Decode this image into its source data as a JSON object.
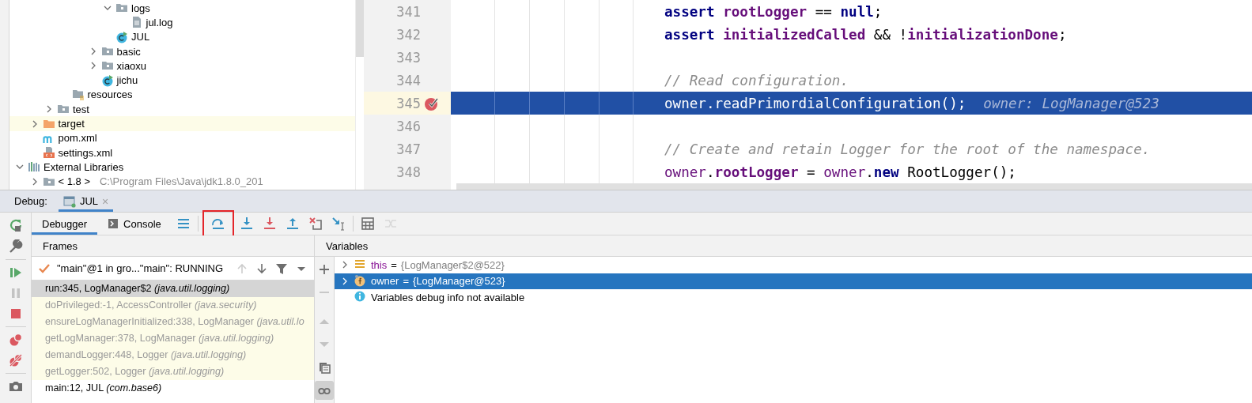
{
  "project_tree": {
    "items": [
      {
        "children": [
          {
            "children": [
              {
                "children": [
                  {
                    "children": [
                      {
                        "children": [
                          {
                            "children": [
                              {
                                "label": "logs",
                                "kind": "folder",
                                "expanded": true,
                                "selected": false,
                                "children": [
                                  {
                                    "label": "jul.log",
                                    "kind": "file",
                                    "selected": false
                                  }
                                ]
                              },
                              {
                                "label": "JUL",
                                "kind": "class",
                                "selected": false
                              }
                            ]
                          },
                          {
                            "label": "basic",
                            "kind": "folder",
                            "expanded": false,
                            "selected": false
                          },
                          {
                            "label": "xiaoxu",
                            "kind": "folder",
                            "expanded": false,
                            "selected": false
                          },
                          {
                            "label": "jichu",
                            "kind": "class",
                            "selected": false
                          }
                        ]
                      }
                    ]
                  },
                  {
                    "label": "resources",
                    "kind": "resources",
                    "selected": false
                  }
                ]
              },
              {
                "label": "test",
                "kind": "folder",
                "expanded": false,
                "selected": false
              }
            ]
          },
          {
            "label": "target",
            "kind": "excluded",
            "expanded": false,
            "selected": true
          },
          {
            "label": "pom.xml",
            "kind": "maven",
            "selected": false
          },
          {
            "label": "settings.xml",
            "kind": "settings",
            "selected": false
          }
        ]
      },
      {
        "label": "External Libraries",
        "kind": "libraries",
        "expanded": true,
        "selected": false,
        "children": [
          {
            "label": "< 1.8 >",
            "path": "C:\\Program Files\\Java\\jdk1.8.0_201",
            "kind": "folder",
            "expanded": false,
            "selected": false
          }
        ]
      }
    ]
  },
  "editor": {
    "lines": [
      {
        "number": "341",
        "current": false,
        "breakpoint": false,
        "tokens": [
          {
            "kind": "keyword",
            "text": "assert"
          },
          {
            "kind": "field",
            "text": " rootLogger"
          },
          {
            "kind": "plain",
            "text": " == "
          },
          {
            "kind": "keyword",
            "text": "null"
          },
          {
            "kind": "plain",
            "text": ";"
          }
        ]
      },
      {
        "number": "342",
        "current": false,
        "breakpoint": false,
        "tokens": [
          {
            "kind": "keyword",
            "text": "assert"
          },
          {
            "kind": "field",
            "text": " initializedCalled"
          },
          {
            "kind": "plain",
            "text": " && !"
          },
          {
            "kind": "field",
            "text": "initializationDone"
          },
          {
            "kind": "plain",
            "text": ";"
          }
        ]
      },
      {
        "number": "343",
        "current": false,
        "breakpoint": false
      },
      {
        "number": "344",
        "current": false,
        "breakpoint": false,
        "tokens": [
          {
            "kind": "comment",
            "text": "// Read configuration."
          }
        ]
      },
      {
        "number": "345",
        "current": true,
        "breakpoint": true,
        "tokens": [
          {
            "kind": "variable",
            "text": "owner"
          },
          {
            "kind": "plain",
            "text": ".readPrimordialConfiguration();"
          }
        ],
        "hint": "owner: LogManager@523"
      },
      {
        "number": "346",
        "current": false,
        "breakpoint": false
      },
      {
        "number": "347",
        "current": false,
        "breakpoint": false,
        "tokens": [
          {
            "kind": "comment",
            "text": "// Create and retain Logger for the root of the namespace."
          }
        ]
      },
      {
        "number": "348",
        "current": false,
        "breakpoint": false,
        "tokens": [
          {
            "kind": "variable",
            "text": "owner"
          },
          {
            "kind": "plain",
            "text": "."
          },
          {
            "kind": "field",
            "text": "rootLogger"
          },
          {
            "kind": "plain",
            "text": " = "
          },
          {
            "kind": "variable",
            "text": "owner"
          },
          {
            "kind": "plain",
            "text": "."
          },
          {
            "kind": "keyword",
            "text": "new"
          },
          {
            "kind": "plain",
            "text": " RootLogger();"
          }
        ]
      }
    ]
  },
  "debug": {
    "title": "Debug:",
    "session_tab": {
      "label": "JUL",
      "close": "×",
      "selected": true
    },
    "side_toolbar": [
      {
        "disabled": false
      },
      {
        "disabled": false
      },
      {
        "disabled": false
      },
      {
        "disabled": true
      },
      {
        "disabled": false
      },
      {
        "disabled": false
      },
      {
        "disabled": false
      },
      {
        "disabled": false
      }
    ],
    "tabs": [
      {
        "label": "Debugger",
        "selected": true
      },
      {
        "label": "Console",
        "selected": false
      }
    ],
    "toolbar": [
      {
        "disabled": false,
        "outlined": false
      },
      {
        "disabled": false,
        "outlined": true
      },
      {
        "disabled": false,
        "outlined": false
      },
      {
        "disabled": false,
        "outlined": false
      },
      {
        "disabled": false,
        "outlined": false
      },
      {
        "disabled": false,
        "outlined": false
      },
      {
        "disabled": false,
        "outlined": false
      },
      {
        "disabled": false,
        "outlined": false
      },
      {
        "disabled": true,
        "outlined": false
      }
    ],
    "frames": {
      "title": "Frames",
      "thread": "\"main\"@1 in gro...\"main\": RUNNING",
      "thread_controls": [
        {
          "disabled": true
        },
        {
          "disabled": false
        },
        {
          "disabled": false
        },
        {
          "disabled": false
        }
      ],
      "items": [
        {
          "text": "run:345, LogManager$2 *(java.util.logging)*",
          "selected": true,
          "library": false
        },
        {
          "text": "doPrivileged:-1, AccessController *(java.security)*",
          "selected": false,
          "library": true
        },
        {
          "text": "ensureLogManagerInitialized:338, LogManager *(java.util.lo*",
          "selected": false,
          "library": true
        },
        {
          "text": "getLogManager:378, LogManager *(java.util.logging)*",
          "selected": false,
          "library": true
        },
        {
          "text": "demandLogger:448, Logger *(java.util.logging)*",
          "selected": false,
          "library": true
        },
        {
          "text": "getLogger:502, Logger *(java.util.logging)*",
          "selected": false,
          "library": true
        },
        {
          "text": "main:12, JUL *(com.base6)*",
          "selected": false,
          "library": false
        }
      ]
    },
    "variables": {
      "title": "Variables",
      "mini_toolbar": [
        {
          "disabled": false,
          "selected": false
        },
        {
          "disabled": true,
          "selected": false
        },
        {
          "disabled": true,
          "selected": false
        },
        {
          "disabled": true,
          "selected": false
        },
        {
          "disabled": false,
          "selected": false
        },
        {
          "disabled": false,
          "selected": true
        }
      ],
      "items": [
        {
          "kind": "local",
          "name": "this",
          "equals": "=",
          "value": "{LogManager$2@522}",
          "expanded": false,
          "selected": false
        },
        {
          "kind": "field",
          "name": "owner",
          "equals": "=",
          "value": "{LogManager@523}",
          "expanded": false,
          "selected": true
        },
        {
          "kind": "info",
          "text": "Variables debug info not available"
        }
      ]
    }
  }
}
